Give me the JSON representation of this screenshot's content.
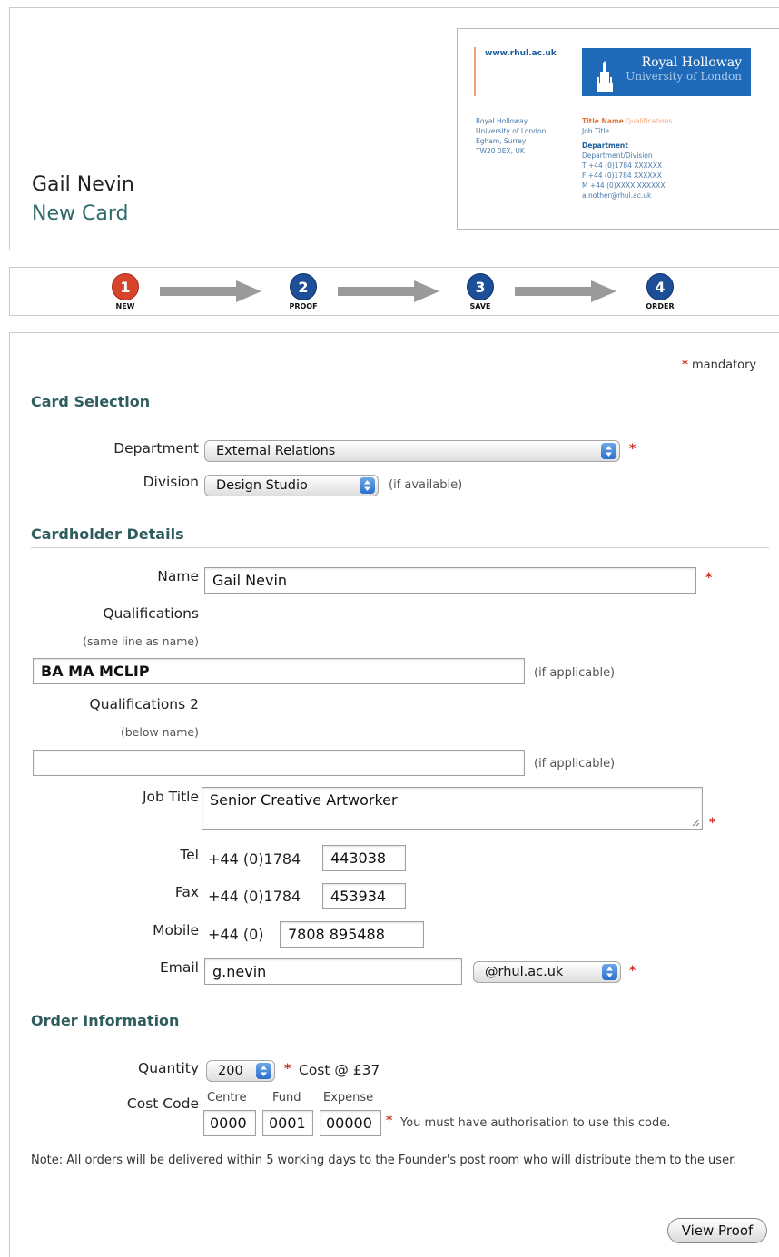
{
  "header": {
    "holder_name": "Gail Nevin",
    "card_status": "New Card"
  },
  "card_preview": {
    "url": "www.rhul.ac.uk",
    "logo_line1": "Royal Holloway",
    "logo_line2": "University of London",
    "address": [
      "Royal Holloway",
      "University of London",
      "Egham, Surrey",
      "TW20 0EX, UK"
    ],
    "title_name": "Title Name",
    "qualifications": "Qualifications",
    "job_title": "Job Title",
    "department": "Department",
    "division": "Department/Division",
    "tel": "T +44 (0)1784 XXXXXX",
    "fax": "F +44 (0)1784 XXXXXX",
    "mobile": "M +44 (0)XXXX XXXXXX",
    "email": "a.nother@rhul.ac.uk"
  },
  "steps": [
    {
      "number": "1",
      "label": "NEW"
    },
    {
      "number": "2",
      "label": "PROOF"
    },
    {
      "number": "3",
      "label": "SAVE"
    },
    {
      "number": "4",
      "label": "ORDER"
    }
  ],
  "form": {
    "mandatory_marker": "*",
    "mandatory_text": "mandatory",
    "card_selection": {
      "title": "Card Selection",
      "department_label": "Department",
      "department_value": "External Relations",
      "division_label": "Division",
      "division_value": "Design Studio",
      "division_hint": "(if available)"
    },
    "cardholder": {
      "title": "Cardholder Details",
      "name_label": "Name",
      "name_value": "Gail Nevin",
      "quals_label": "Qualifications",
      "quals_sub": "(same line as name)",
      "quals_value": "BA MA MCLIP",
      "quals_hint": "(if applicable)",
      "quals2_label": "Qualifications 2",
      "quals2_sub": "(below name)",
      "quals2_value": "",
      "quals2_hint": "(if applicable)",
      "job_label": "Job Title",
      "job_value": "Senior Creative Artworker",
      "tel_label": "Tel",
      "tel_prefix": "+44 (0)1784",
      "tel_value": "443038",
      "fax_label": "Fax",
      "fax_prefix": "+44 (0)1784",
      "fax_value": "453934",
      "mobile_label": "Mobile",
      "mobile_prefix": "+44 (0)",
      "mobile_value": "7808 895488",
      "email_label": "Email",
      "email_value": "g.nevin",
      "email_domain": "@rhul.ac.uk"
    },
    "order": {
      "title": "Order Information",
      "quantity_label": "Quantity",
      "quantity_value": "200",
      "cost_text": "Cost @ £37",
      "cost_code_label": "Cost Code",
      "centre_label": "Centre",
      "centre_value": "0000",
      "fund_label": "Fund",
      "fund_value": "0001",
      "expense_label": "Expense",
      "expense_value": "00000",
      "auth_text": "You must have authorisation to use this code."
    },
    "note": "Note: All orders will be delivered within 5 working days to the Founder's post room who will distribute them to the user.",
    "view_proof_label": "View Proof"
  }
}
